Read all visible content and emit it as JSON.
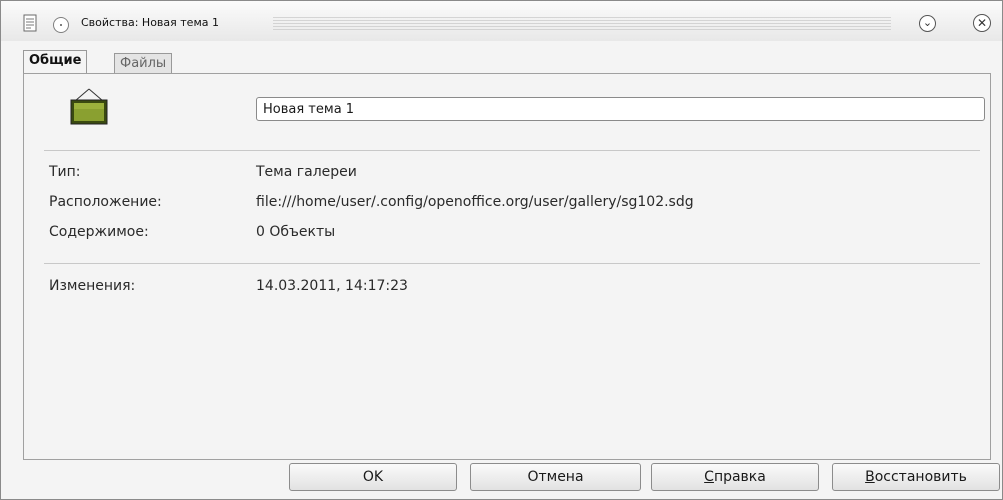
{
  "window": {
    "title": "Свойства: Новая тема 1",
    "icons": {
      "app": "gallery-doc-icon",
      "menu": "window-menu-icon",
      "minimize": "minimize-icon",
      "close": "close-icon"
    },
    "minimize_glyph": "⌄",
    "close_glyph": "✕"
  },
  "tabs": [
    {
      "label": "Общие",
      "active": true
    },
    {
      "label": "Файлы",
      "active": false
    }
  ],
  "general": {
    "theme_icon": "picture-frame-icon",
    "name_value": "Новая тема 1",
    "rows": [
      {
        "label": "Тип:",
        "value": "Тема галереи"
      },
      {
        "label": "Расположение:",
        "value": "file:///home/user/.config/openoffice.org/user/gallery/sg102.sdg"
      },
      {
        "label": "Содержимое:",
        "value": "0 Объекты"
      },
      {
        "label": "Изменения:",
        "value": "14.03.2011, 14:17:23"
      }
    ]
  },
  "buttons": {
    "ok": "OK",
    "cancel": "Отмена",
    "help": {
      "mnemonic": "С",
      "rest": "правка"
    },
    "restore": {
      "mnemonic": "В",
      "rest": "осстановить"
    }
  },
  "colors": {
    "accent_green": "#8aa030",
    "frame_dark": "#3a4a10"
  }
}
